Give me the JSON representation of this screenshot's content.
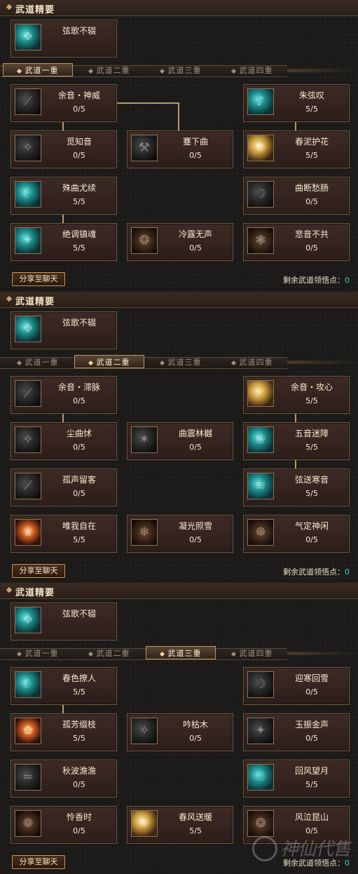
{
  "panels": [
    {
      "header_title": "武道精要",
      "essence": {
        "name": "弦歌不辍"
      },
      "tabs": [
        {
          "label": "武道一重"
        },
        {
          "label": "武道二重"
        },
        {
          "label": "武道三重"
        },
        {
          "label": "武道四重"
        }
      ],
      "selected_tab": "武道一重",
      "skills": [
        {
          "name": "余音・神威",
          "value": "0/5"
        },
        {
          "name": "朱弦叹",
          "value": "5/5"
        },
        {
          "name": "觅知音",
          "value": "0/5"
        },
        {
          "name": "蹇下曲",
          "value": "0/5"
        },
        {
          "name": "春泥护花",
          "value": "5/5"
        },
        {
          "name": "殊曲尤续",
          "value": "5/5"
        },
        {
          "name": "曲断愁肠",
          "value": "0/5"
        },
        {
          "name": "绝调镇魂",
          "value": "5/5"
        },
        {
          "name": "冷露无声",
          "value": "0/5"
        },
        {
          "name": "悲音不共",
          "value": "0/5"
        }
      ],
      "share_label": "分享至聊天",
      "remaining_label": "剩余武道领悟点：",
      "remaining_value": "0"
    },
    {
      "header_title": "武道精要",
      "essence": {
        "name": "弦歌不辍"
      },
      "tabs": [
        {
          "label": "武道一重"
        },
        {
          "label": "武道二重"
        },
        {
          "label": "武道三重"
        },
        {
          "label": "武道四重"
        }
      ],
      "selected_tab": "武道二重",
      "skills": [
        {
          "name": "余音・滞脉",
          "value": "0/5"
        },
        {
          "name": "余音・攻心",
          "value": "5/5"
        },
        {
          "name": "尘曲怵",
          "value": "0/5"
        },
        {
          "name": "曲震林樾",
          "value": "0/5"
        },
        {
          "name": "五音迷障",
          "value": "5/5"
        },
        {
          "name": "孤声留客",
          "value": "0/5"
        },
        {
          "name": "弦送寒音",
          "value": "5/5"
        },
        {
          "name": "唯我自在",
          "value": "5/5"
        },
        {
          "name": "凝光照雪",
          "value": "0/5"
        },
        {
          "name": "气定神闲",
          "value": "0/5"
        }
      ],
      "share_label": "分享至聊天",
      "remaining_label": "剩余武道领悟点：",
      "remaining_value": "0"
    },
    {
      "header_title": "武道精要",
      "essence": {
        "name": "弦歌不辍"
      },
      "tabs": [
        {
          "label": "武道一重"
        },
        {
          "label": "武道二重"
        },
        {
          "label": "武道三重"
        },
        {
          "label": "武道四重"
        }
      ],
      "selected_tab": "武道三重",
      "skills": [
        {
          "name": "春色撩人",
          "value": "5/5"
        },
        {
          "name": "迎寒回雪",
          "value": "0/5"
        },
        {
          "name": "孤芳缀枝",
          "value": "5/5"
        },
        {
          "name": "吟枯木",
          "value": "0/5"
        },
        {
          "name": "玉振金声",
          "value": "0/5"
        },
        {
          "name": "秋波澹澹",
          "value": "0/5"
        },
        {
          "name": "回风望月",
          "value": "5/5"
        },
        {
          "name": "怜香时",
          "value": "0/5"
        },
        {
          "name": "春风送暖",
          "value": "5/5"
        },
        {
          "name": "风泣昆山",
          "value": "0/5"
        }
      ],
      "share_label": "分享至聊天",
      "remaining_label": "剩余武道领悟点：",
      "remaining_value": "0"
    }
  ],
  "watermark": {
    "text": "神仙代售"
  }
}
